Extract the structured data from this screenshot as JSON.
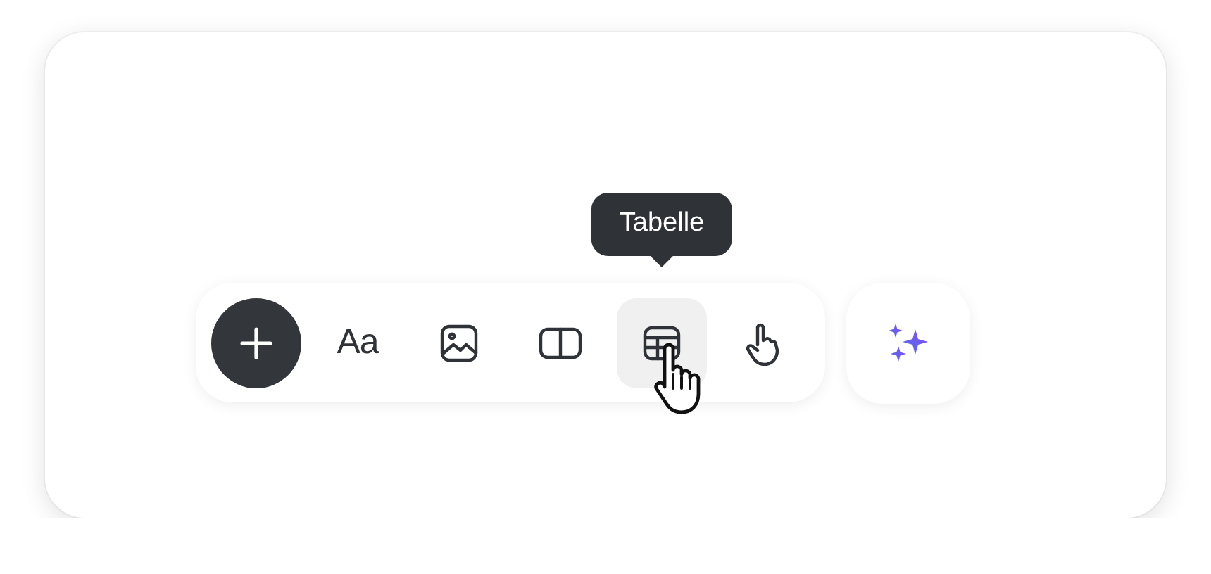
{
  "toolbar": {
    "tools": [
      {
        "kind": "add",
        "hovered": false
      },
      {
        "kind": "text",
        "label": "Aa",
        "hovered": false
      },
      {
        "kind": "image",
        "hovered": false
      },
      {
        "kind": "columns",
        "hovered": false
      },
      {
        "kind": "table",
        "hovered": true
      },
      {
        "kind": "gesture",
        "hovered": false
      }
    ],
    "tooltip": "Tabelle"
  },
  "ai_button": {
    "kind": "sparkle"
  }
}
